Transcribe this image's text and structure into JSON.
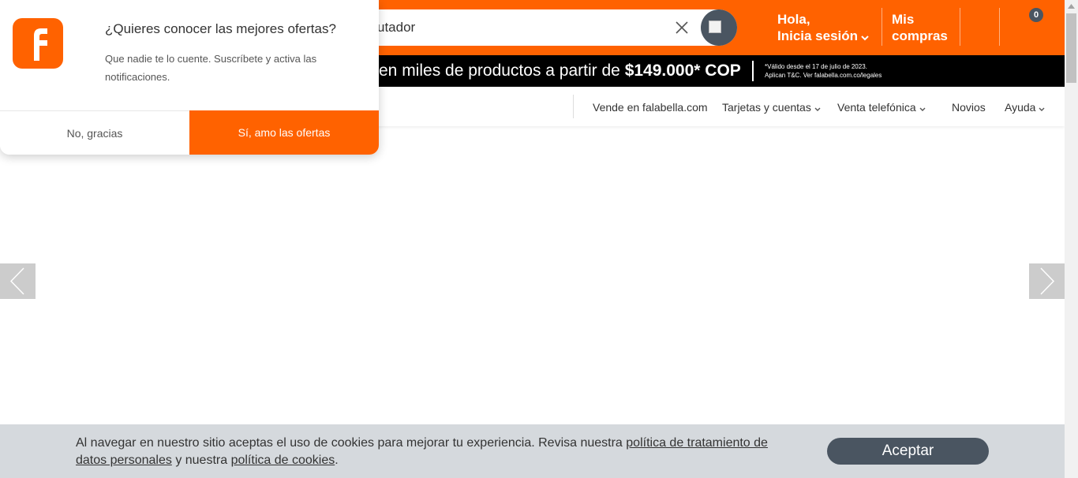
{
  "search": {
    "value": "utador"
  },
  "header": {
    "login_line1": "Hola,",
    "login_line2": "Inicia sesión",
    "orders_line1": "Mis",
    "orders_line2": "compras",
    "cart_count": "0"
  },
  "promo": {
    "text": "en miles de productos a partir de",
    "price": "$149.000* COP",
    "legal_line1": "*Válido desde el 17 de julio de 2023.",
    "legal_line2": "Aplican T&C. Ver falabella.com.co/legales"
  },
  "nav": [
    {
      "label": "Vende en falabella.com"
    },
    {
      "label": "Tarjetas y cuentas"
    },
    {
      "label": "Venta telefónica"
    },
    {
      "label": "Novios"
    },
    {
      "label": "Ayuda"
    }
  ],
  "cookies": {
    "text_before": "Al navegar en nuestro sitio aceptas el uso de cookies para mejorar tu experiencia. Revisa nuestra",
    "link_privacy": "política de tratamiento de datos personales",
    "text_middle": "y nuestra",
    "link_cookies": "política de cookies",
    "text_end": ".",
    "accept_label": "Aceptar"
  },
  "modal": {
    "logo_letter": "f",
    "title": "¿Quieres conocer las mejores ofertas?",
    "body": "Que nadie te lo cuente. Suscríbete y activa las notificaciones.",
    "no_label": "No, gracias",
    "yes_label": "Sí, amo las ofertas"
  },
  "colors": {
    "brand": "#ff6200",
    "dark": "#4a5561",
    "promo_bg": "#000000",
    "cookie_bg": "#d5d9dd"
  }
}
